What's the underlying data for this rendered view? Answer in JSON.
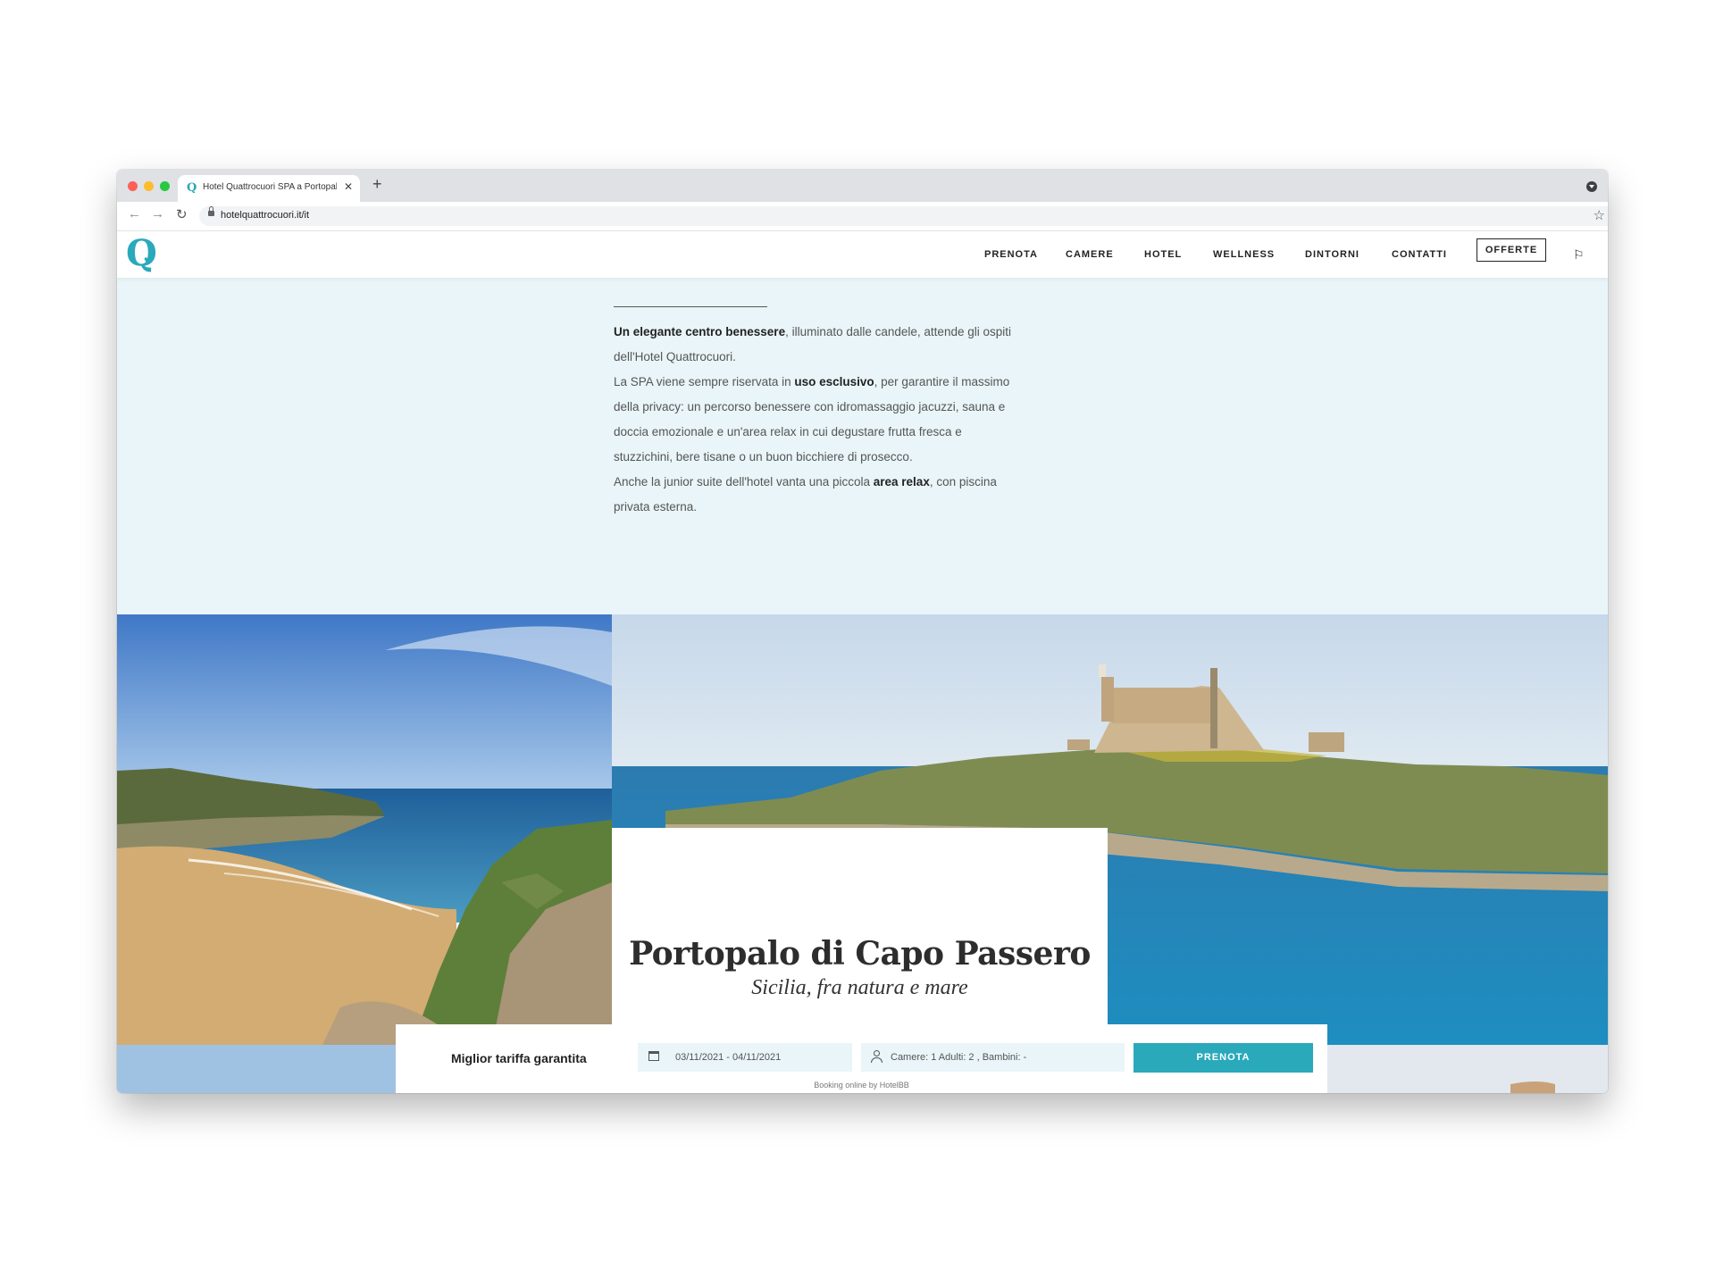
{
  "browser": {
    "tab_title": "Hotel Quattrocuori SPA a Portopalo",
    "tab_favicon": "Q",
    "new_tab": "+",
    "tab_close": "✕",
    "url": "hotelquattrocuori.it/it",
    "icons": [
      "back-icon",
      "forward-icon",
      "reload-icon",
      "lock-icon",
      "star-icon",
      "profile-icon"
    ]
  },
  "header": {
    "logo": "Q",
    "menu": [
      "PRENOTA",
      "CAMERE",
      "HOTEL",
      "WELLNESS",
      "DINTORNI",
      "CONTATTI"
    ],
    "offers": "OFFERTE",
    "flag_icon": "flag-icon",
    "accent_color": "#2aa9bb"
  },
  "spa": {
    "p1_bold": "Un elegante centro benessere",
    "p1_rest": ", illuminato dalle candele, attende gli ospiti dell'Hotel Quattrocuori.",
    "p2_start": "La SPA viene sempre riservata in ",
    "p2_bold": "uso esclusivo",
    "p2_rest": ", per garantire il massimo della privacy: un percorso benessere con idromassaggio jacuzzi, sauna e doccia emozionale e un'area relax in cui degustare frutta fresca e stuzzichini, bere tisane o un buon bicchiere di prosecco.",
    "p3_start": "Anche la junior suite dell'hotel vanta una piccola ",
    "p3_bold": "area relax",
    "p3_rest": ", con piscina privata esterna.",
    "background": "#e9f5f8"
  },
  "location": {
    "title": "Portopalo di Capo Passero",
    "subtitle": "Sicilia, fra natura e mare"
  },
  "booking": {
    "label": "Miglior tariffa garantita",
    "dates": "03/11/2021 - 04/11/2021",
    "rooms": "Camere: 1  Adulti: 2 , Bambini: -",
    "button": "PRENOTA",
    "credit": "Booking online by HotelBB"
  }
}
